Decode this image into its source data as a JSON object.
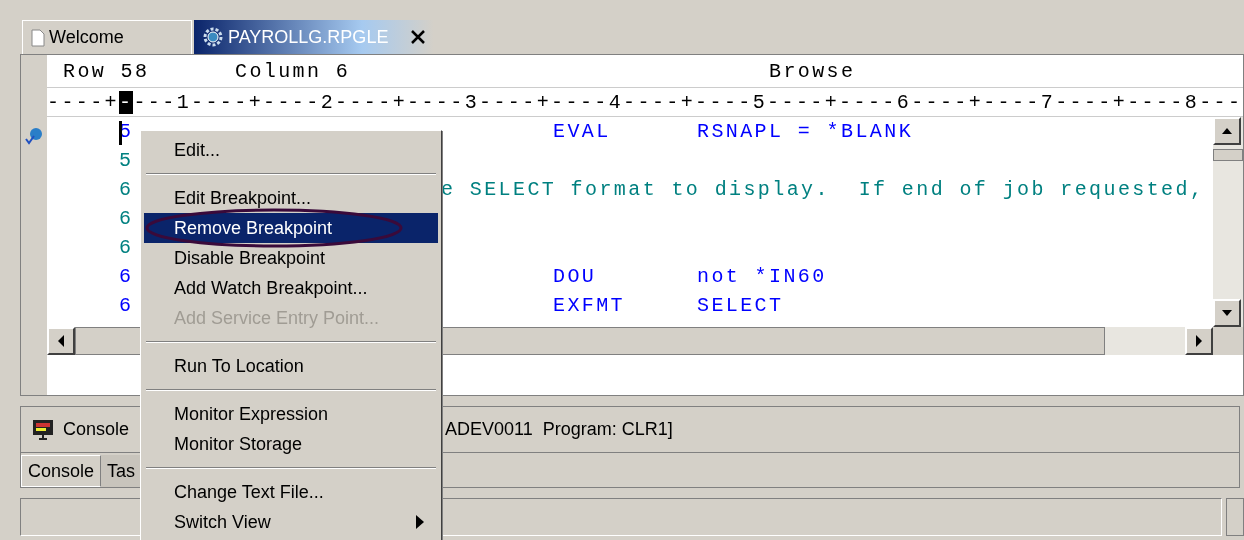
{
  "editor_tabs": [
    {
      "label": "Welcome",
      "selected": false
    },
    {
      "label": "PAYROLLG.RPGLE",
      "selected": true
    }
  ],
  "status_line": {
    "row": "Row 58",
    "column": "Column 6",
    "mode": "Browse"
  },
  "ruler": {
    "before": "----+",
    "cursor": "-",
    "after": "---1----+----2----+----3----+----4----+----5----+----6----+----7----+----8---"
  },
  "code_lines": [
    {
      "number": "5",
      "kind": "code",
      "breakpoint": true,
      "opcode": "EVAL",
      "operands": "RSNAPL = *BLANK"
    },
    {
      "number": "5",
      "kind": "comment",
      "breakpoint": false
    },
    {
      "number": "6",
      "kind": "comment",
      "breakpoint": false,
      "text": "e SELECT format to display.  If end of job requested,"
    },
    {
      "number": "6",
      "kind": "comment",
      "breakpoint": false
    },
    {
      "number": "6",
      "kind": "comment",
      "breakpoint": false
    },
    {
      "number": "6",
      "kind": "code",
      "breakpoint": false,
      "opcode": "DOU",
      "operands": "not *IN60"
    },
    {
      "number": "6",
      "kind": "code",
      "breakpoint": false,
      "opcode": "EXFMT",
      "operands": "SELECT"
    }
  ],
  "context_menu": [
    {
      "kind": "item",
      "label": "Edit...",
      "selected": false,
      "disabled": false,
      "submenu": false,
      "circled": false
    },
    {
      "kind": "separator"
    },
    {
      "kind": "item",
      "label": "Edit Breakpoint...",
      "selected": false,
      "disabled": false,
      "submenu": false,
      "circled": false
    },
    {
      "kind": "item",
      "label": "Remove Breakpoint",
      "selected": true,
      "disabled": false,
      "submenu": false,
      "circled": true
    },
    {
      "kind": "item",
      "label": "Disable Breakpoint",
      "selected": false,
      "disabled": false,
      "submenu": false,
      "circled": false
    },
    {
      "kind": "item",
      "label": "Add Watch Breakpoint...",
      "selected": false,
      "disabled": false,
      "submenu": false,
      "circled": false
    },
    {
      "kind": "item",
      "label": "Add Service Entry Point...",
      "selected": false,
      "disabled": true,
      "submenu": false,
      "circled": false
    },
    {
      "kind": "separator"
    },
    {
      "kind": "item",
      "label": "Run To Location",
      "selected": false,
      "disabled": false,
      "submenu": false,
      "circled": false
    },
    {
      "kind": "separator"
    },
    {
      "kind": "item",
      "label": "Monitor Expression",
      "selected": false,
      "disabled": false,
      "submenu": false,
      "circled": false
    },
    {
      "kind": "item",
      "label": "Monitor Storage",
      "selected": false,
      "disabled": false,
      "submenu": false,
      "circled": false
    },
    {
      "kind": "separator"
    },
    {
      "kind": "item",
      "label": "Change Text File...",
      "selected": false,
      "disabled": false,
      "submenu": false,
      "circled": false
    },
    {
      "kind": "item",
      "label": "Switch View",
      "selected": false,
      "disabled": false,
      "submenu": true,
      "circled": false
    }
  ],
  "console": {
    "title": "Console",
    "description": "ADEV0011  Program: CLR1]"
  },
  "bottom_tabs": [
    {
      "label": "Console",
      "selected": true
    },
    {
      "label": "Tas",
      "selected": false
    }
  ]
}
